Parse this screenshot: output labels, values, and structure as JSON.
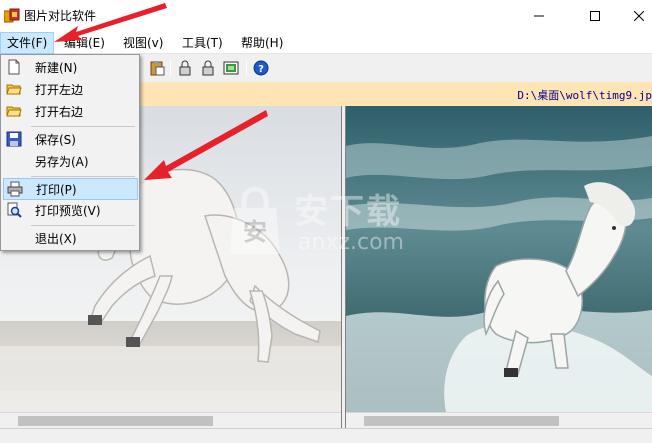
{
  "window": {
    "title": "图片对比软件",
    "min_glyph": "—",
    "max_glyph": "☐",
    "close_glyph": "✕"
  },
  "menubar": [
    {
      "label": "文件(F)",
      "active": true
    },
    {
      "label": "编辑(E)"
    },
    {
      "label": "视图(v)"
    },
    {
      "label": "工具(T)"
    },
    {
      "label": "帮助(H)"
    }
  ],
  "toolbar": {
    "icons": [
      "new-icon",
      "open-left-icon",
      "open-right-icon",
      "save-icon",
      "copy-icon",
      "paste-icon",
      "lock-left-icon",
      "lock-right-icon",
      "image-icon",
      "help-icon"
    ]
  },
  "path": {
    "text": "D:\\桌面\\wolf\\timg9.jp"
  },
  "file_menu": {
    "items": [
      {
        "label": "新建(N)",
        "icon": "new-file-icon"
      },
      {
        "label": "打开左边",
        "icon": "folder-open-icon"
      },
      {
        "label": "打开右边",
        "icon": "folder-open-icon"
      },
      {
        "label": "保存(S)",
        "icon": "save-icon"
      },
      {
        "label": "另存为(A)",
        "icon": ""
      },
      {
        "label": "打印(P)",
        "icon": "printer-icon",
        "highlighted": true
      },
      {
        "label": "打印预览(V)",
        "icon": "print-preview-icon"
      },
      {
        "label": "退出(X)",
        "icon": ""
      }
    ]
  },
  "watermark": {
    "cn": "安下载",
    "en": "anxz.com"
  },
  "colors": {
    "menu_highlight": "#cce8ff",
    "path_bar": "#ffe4b5",
    "path_text": "#00008b",
    "arrow": "#e8202a"
  }
}
